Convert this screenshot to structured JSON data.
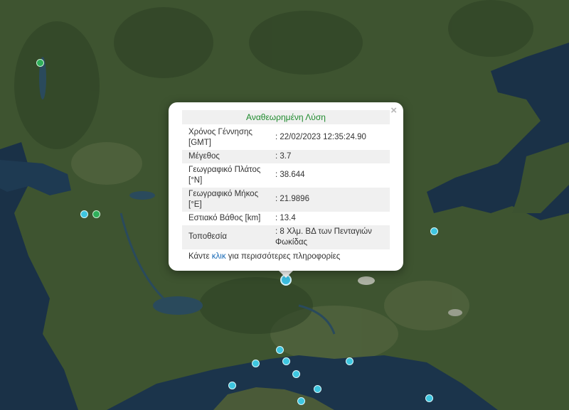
{
  "popup": {
    "title": "Αναθεωρημένη Λύση",
    "close_glyph": "×",
    "rows": [
      {
        "label": "Χρόνος Γέννησης [GMT]",
        "value": ": 22/02/2023 12:35:24.90"
      },
      {
        "label": "Μέγεθος",
        "value": ": 3.7"
      },
      {
        "label": "Γεωγραφικό Πλάτος [°N]",
        "value": ": 38.644"
      },
      {
        "label": "Γεωγραφικό Μήκος [°E]",
        "value": ": 21.9896"
      },
      {
        "label": "Εστιακό Βάθος [km]",
        "value": ": 13.4"
      },
      {
        "label": "Τοποθεσία",
        "value": ": 8 Χλμ. ΒΔ των Πενταγιών Φωκίδας"
      }
    ],
    "footer": {
      "before": "Κάντε ",
      "link": "κλικ",
      "after": " για περισσότερες πληροφορίες"
    }
  },
  "colors": {
    "title_green": "#1d8a2c",
    "link_blue": "#1769b6",
    "marker_cyan": "#3ec6e0",
    "marker_green": "#2fae5a",
    "sea": "#1a3147",
    "land": "#3f5530"
  }
}
